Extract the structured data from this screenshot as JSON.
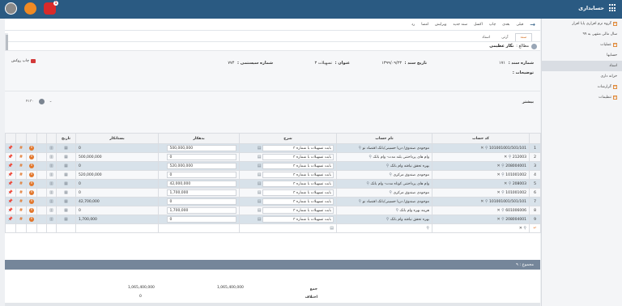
{
  "app": {
    "title": "حسابداری"
  },
  "topbar": {
    "notif_count": "1"
  },
  "sidebar": {
    "items": [
      {
        "label": "گروه نرم افزاری پایا افزار",
        "plus": true
      },
      {
        "label": "سال مالی منتهی به ۹۹",
        "plus": false
      },
      {
        "label": "عملیات",
        "plus": true
      },
      {
        "label": "حسابها",
        "plus": false
      },
      {
        "label": "اسناد",
        "plus": false,
        "active": true
      },
      {
        "label": "خزانه داری",
        "plus": false
      },
      {
        "label": "گزارشات",
        "plus": true
      },
      {
        "label": "تنظیمات",
        "plus": true
      }
    ]
  },
  "toolbar": {
    "items": [
      "قبلی",
      "بعدی",
      "چاپ",
      "اکسل",
      "سند جدید",
      "ویرایش",
      "امضا",
      "رد"
    ]
  },
  "tabs": {
    "items": [
      "سند",
      "آرتی",
      "اسناد"
    ]
  },
  "user": {
    "prefix": "مطالع :",
    "name": "نگار عظیمی"
  },
  "doc": {
    "number_label": "شماره سند :",
    "number_value": "۱۷۱",
    "date_label": "تاریخ سند :",
    "date_value": "۱۳۹۹/۰۹/۲۳",
    "title_label": "عنوان :",
    "title_value": "تسهیلات ۳",
    "system_label": "شماره سیستمی :",
    "system_value": "۷۷۴",
    "desc_label": "توضیحات :",
    "print_label": "چاپ روکش",
    "more_label": "بیشتر",
    "ref_value": "۴۱۳۰",
    "ref_arrow": "⌄"
  },
  "grid": {
    "headers": [
      "",
      "کد حساب",
      "نام حساب",
      "شرح",
      "بدهکار",
      "بستانکار",
      "تاریخ",
      "",
      "",
      "",
      "",
      ""
    ],
    "rows": [
      {
        "n": "1",
        "code": "101001001/501/101",
        "name": "موجودی صندوق/ دریا حسینی/بانک اقتصاد نو",
        "desc": "بابت تسهیلات با شماره ۳",
        "debit": "500,000,000",
        "credit": "0"
      },
      {
        "n": "2",
        "code": "212003",
        "name": "وام های پرداختنی بلند مدت- وام بانک",
        "desc": "بابت تسهیلات با شماره ۳",
        "debit": "0",
        "credit": "500,000,000"
      },
      {
        "n": "3",
        "code": "208004001",
        "name": "بهره تحقق نیافته وام بانک",
        "desc": "بابت تسهیلات با شماره ۳",
        "debit": "520,000,000",
        "credit": "0"
      },
      {
        "n": "4",
        "code": "101001002",
        "name": "موجودی صندوق مرکزی",
        "desc": "بابت تسهیلات با شماره ۳",
        "debit": "0",
        "credit": "520,000,000"
      },
      {
        "n": "5",
        "code": "208003",
        "name": "وام های پرداختنی کوتاه مدت- وام بانک",
        "desc": "بابت تسهیلات با شماره ۳",
        "debit": "42,000,000",
        "credit": "0"
      },
      {
        "n": "6",
        "code": "101001002",
        "name": "موجودی صندوق مرکزی",
        "desc": "بابت تسهیلات با شماره ۳",
        "debit": "1,700,000",
        "credit": "0"
      },
      {
        "n": "7",
        "code": "101001001/501/101",
        "name": "موجودی صندوق/ دریا حسینی/بانک اقتصاد نو",
        "desc": "بابت تسهیلات با شماره ۳",
        "debit": "0",
        "credit": "42,700,000"
      },
      {
        "n": "8",
        "code": "601006006",
        "name": "هزینه بهره وام بانک",
        "desc": "بابت تسهیلات با شماره ۳",
        "debit": "1,700,000",
        "credit": "0"
      },
      {
        "n": "9",
        "code": "208004001",
        "name": "بهره تحقق نیافته وام بانک",
        "desc": "بابت تسهیلات با شماره ۳",
        "debit": "0",
        "credit": "1,700,000"
      }
    ]
  },
  "summary": {
    "bar_label": "مجموع : ۹",
    "sum_label": "جمع",
    "diff_label": "اختلاف",
    "sum_debit": "1,065,400,000",
    "sum_credit": "1,065,400,000",
    "diff_value": "0"
  },
  "colors": {
    "topbar": "#2a5a82",
    "row_odd": "#d8e2ea",
    "accent": "#e2772c"
  }
}
